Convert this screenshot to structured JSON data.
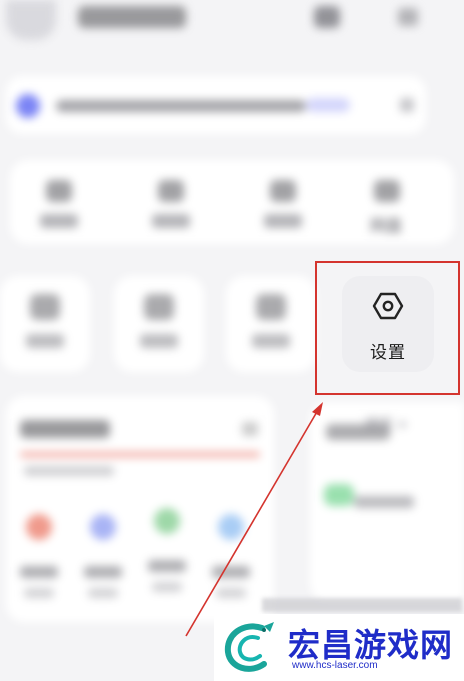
{
  "app": {
    "storage_label": "网盘",
    "lower_right_link": "请视 >"
  },
  "settings_tile": {
    "label": "设置",
    "icon": "hexagon-settings-icon"
  },
  "annotation": {
    "highlight_color": "#d4342e",
    "arrow_color": "#d4342e"
  },
  "watermark": {
    "site_name": "宏昌游戏网",
    "url": "www.hcs-laser.com",
    "brand_color": "#1f2cc8"
  }
}
